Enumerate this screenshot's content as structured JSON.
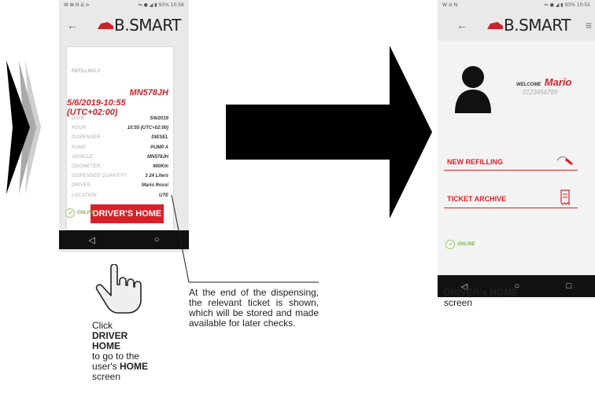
{
  "left_phone": {
    "status_left": "W ⊠ N ⇊ ⊳",
    "status_right": "⇋ ● ◢ ▮ 93% 10:56",
    "logo": "B.SMART",
    "ticket": {
      "title": "REFILLING 2",
      "plate": "MN578JH",
      "datetime": "5/6/2019-10:55 (UTC+02:00)",
      "rows": [
        {
          "label": "DATE",
          "value": "5/6/2019"
        },
        {
          "label": "HOUR",
          "value": "10:55 (UTC+02:00)"
        },
        {
          "label": "DISPENSER",
          "value": "DIESEL"
        },
        {
          "label": "PUMP",
          "value": "PUMP A"
        },
        {
          "label": "VEHICLE",
          "value": "MN578JH"
        },
        {
          "label": "ODOMETER",
          "value": "600Km"
        },
        {
          "label": "DISPENSED QUANTITY",
          "value": "3 24 Liters"
        },
        {
          "label": "DRIVER",
          "value": "Mario Rossi"
        },
        {
          "label": "LOCATION",
          "value": "UTE"
        }
      ]
    },
    "online": "ONLINE",
    "drivers_home_button": "DRIVER'S HOME",
    "nav": [
      "◁",
      "○"
    ]
  },
  "right_phone": {
    "status_left": "W ⊘ N",
    "status_right": "⇋ ● ◢ ▮ 93% 10:55",
    "logo": "B.SMART",
    "welcome": "WELCOME",
    "name": "Mario",
    "code": "0123456789",
    "new_refilling": "NEW REFILLING",
    "ticket_archive": "TICKET ARCHIVE",
    "online": "ONLINE",
    "nav": [
      "◁",
      "○",
      "□"
    ]
  },
  "captions": {
    "click_line1": "Click",
    "click_bold1": "DRIVER",
    "click_bold2": "HOME",
    "click_line2": "to go to the",
    "click_line3": "user's",
    "click_bold3": "HOME",
    "click_line4": "screen",
    "ticket_caption": "At the end of the dispensing, the relevant ticket is shown, which will be stored and made available for later checks.",
    "home_bold": "DRIVER's HOME",
    "home_line": "screen"
  },
  "colors": {
    "accent": "#d72129",
    "online": "#7db64a",
    "nav": "#111111"
  }
}
